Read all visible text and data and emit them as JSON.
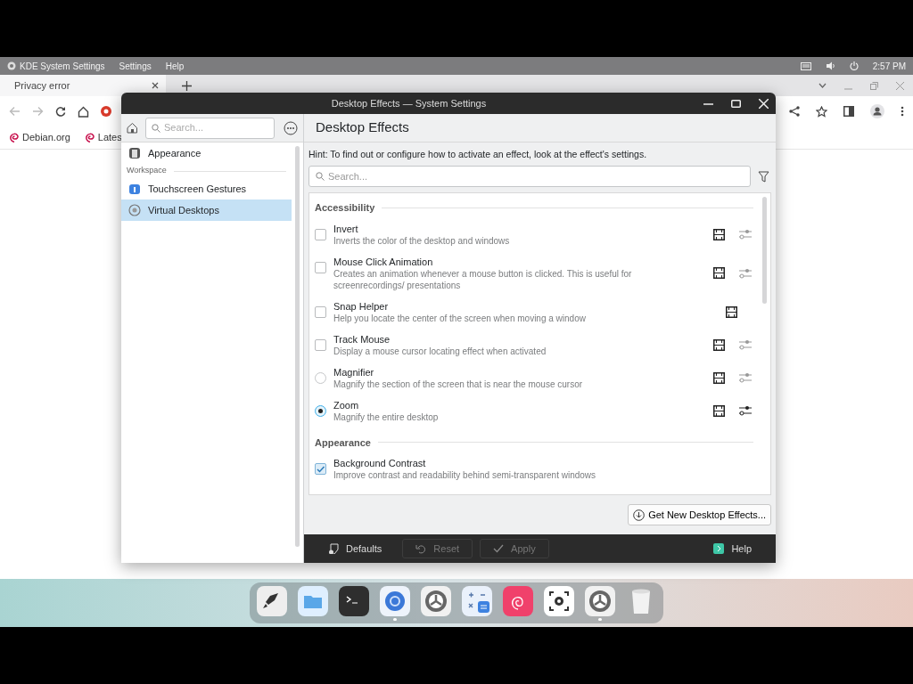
{
  "top_panel": {
    "app_name": "KDE System Settings",
    "menus": [
      "Settings",
      "Help"
    ],
    "clock": "2:57 PM"
  },
  "browser": {
    "tab": {
      "title": "Privacy error"
    },
    "bookmarks": [
      "Debian.org",
      "Lates"
    ]
  },
  "window": {
    "title": "Desktop Effects — System Settings",
    "sidebar": {
      "search_placeholder": "Search...",
      "items": [
        {
          "label": "Appearance",
          "kind": "item",
          "selected": false
        },
        {
          "label": "Workspace",
          "kind": "heading"
        },
        {
          "label": "Touchscreen Gestures",
          "kind": "item",
          "selected": false
        },
        {
          "label": "Virtual Desktops",
          "kind": "item",
          "selected": true
        }
      ]
    },
    "page_title": "Desktop Effects",
    "hint": "Hint: To find out or configure how to activate an effect, look at the effect's settings.",
    "search_placeholder": "Search...",
    "sections": [
      {
        "title": "Accessibility",
        "effects": [
          {
            "name": "Invert",
            "description": "Inverts the color of the desktop and windows",
            "kind": "checkbox",
            "checked": false,
            "video": true,
            "configure": true
          },
          {
            "name": "Mouse Click Animation",
            "description": "Creates an animation whenever a mouse button is clicked. This is useful for screenrecordings/ presentations",
            "kind": "checkbox",
            "checked": false,
            "video": true,
            "configure": true
          },
          {
            "name": "Snap Helper",
            "description": "Help you locate the center of the screen when moving a window",
            "kind": "checkbox",
            "checked": false,
            "video": true,
            "configure": false
          },
          {
            "name": "Track Mouse",
            "description": "Display a mouse cursor locating effect when activated",
            "kind": "checkbox",
            "checked": false,
            "video": true,
            "configure": true
          },
          {
            "name": "Magnifier",
            "description": "Magnify the section of the screen that is near the mouse cursor",
            "kind": "radio",
            "checked": false,
            "video": true,
            "configure": true
          },
          {
            "name": "Zoom",
            "description": "Magnify the entire desktop",
            "kind": "radio",
            "checked": true,
            "video": true,
            "configure": true
          }
        ]
      },
      {
        "title": "Appearance",
        "effects": [
          {
            "name": "Background Contrast",
            "description": "Improve contrast and readability behind semi-transparent windows",
            "kind": "checkbox",
            "checked": true,
            "video": false,
            "configure": false
          }
        ]
      }
    ],
    "get_new_button": "Get New Desktop Effects...",
    "footer_buttons": [
      {
        "label": "Defaults",
        "disabled": false
      },
      {
        "label": "Reset",
        "disabled": true
      },
      {
        "label": "Apply",
        "disabled": true
      }
    ],
    "help_button": "Help"
  },
  "dock": [
    {
      "running": false
    },
    {
      "running": false
    },
    {
      "running": false
    },
    {
      "running": true
    },
    {
      "running": false
    },
    {
      "running": false
    },
    {
      "running": false
    },
    {
      "running": false
    },
    {
      "running": true
    },
    {
      "running": false
    }
  ]
}
